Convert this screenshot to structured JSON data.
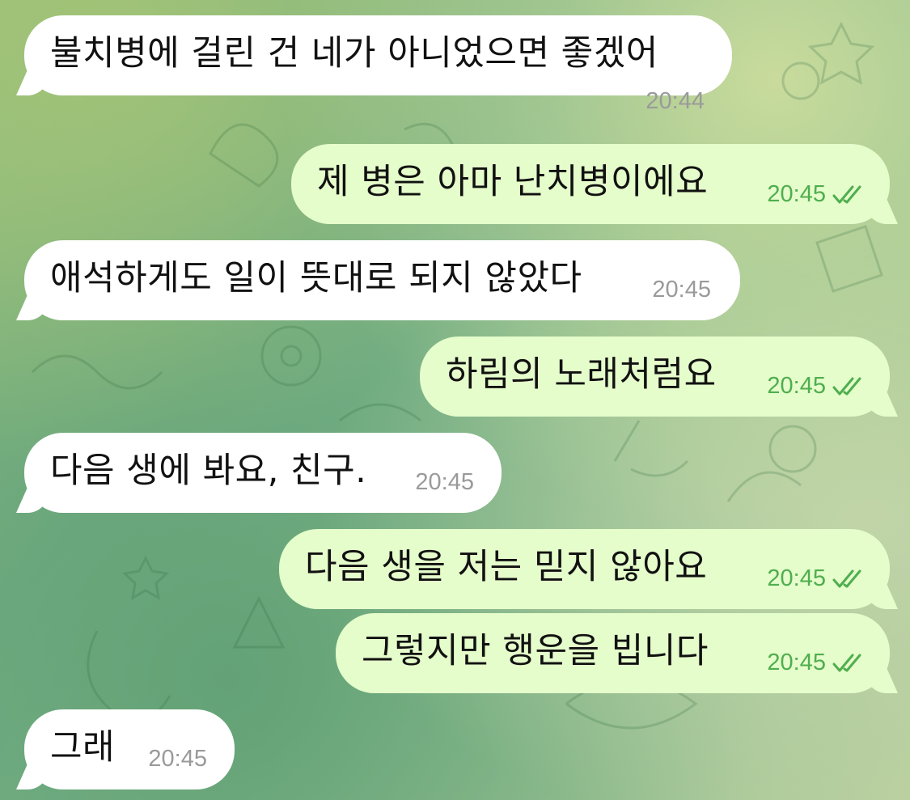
{
  "theme": {
    "incoming_bubble": "#ffffff",
    "outgoing_bubble": "#e5fccb",
    "time_incoming": "#9a9a9a",
    "time_outgoing": "#4fae4e",
    "background_accent": "#74ae84"
  },
  "messages": [
    {
      "direction": "incoming",
      "text": "불치병에 걸린 건 네가 아니었으면 좋겠어",
      "time": "20:44"
    },
    {
      "direction": "outgoing",
      "text": "제 병은 아마 난치병이에요",
      "time": "20:45",
      "status_icon": "double-check-icon"
    },
    {
      "direction": "incoming",
      "text": "애석하게도 일이 뜻대로 되지 않았다",
      "time": "20:45"
    },
    {
      "direction": "outgoing",
      "text": "하림의 노래처럼요",
      "time": "20:45",
      "status_icon": "double-check-icon"
    },
    {
      "direction": "incoming",
      "text": "다음 생에 봐요, 친구.",
      "time": "20:45"
    },
    {
      "direction": "outgoing",
      "text": "다음 생을 저는 믿지 않아요",
      "time": "20:45",
      "status_icon": "double-check-icon"
    },
    {
      "direction": "outgoing",
      "text": "그렇지만 행운을 빕니다",
      "time": "20:45",
      "status_icon": "double-check-icon"
    },
    {
      "direction": "incoming",
      "text": "그래",
      "time": "20:45"
    }
  ]
}
